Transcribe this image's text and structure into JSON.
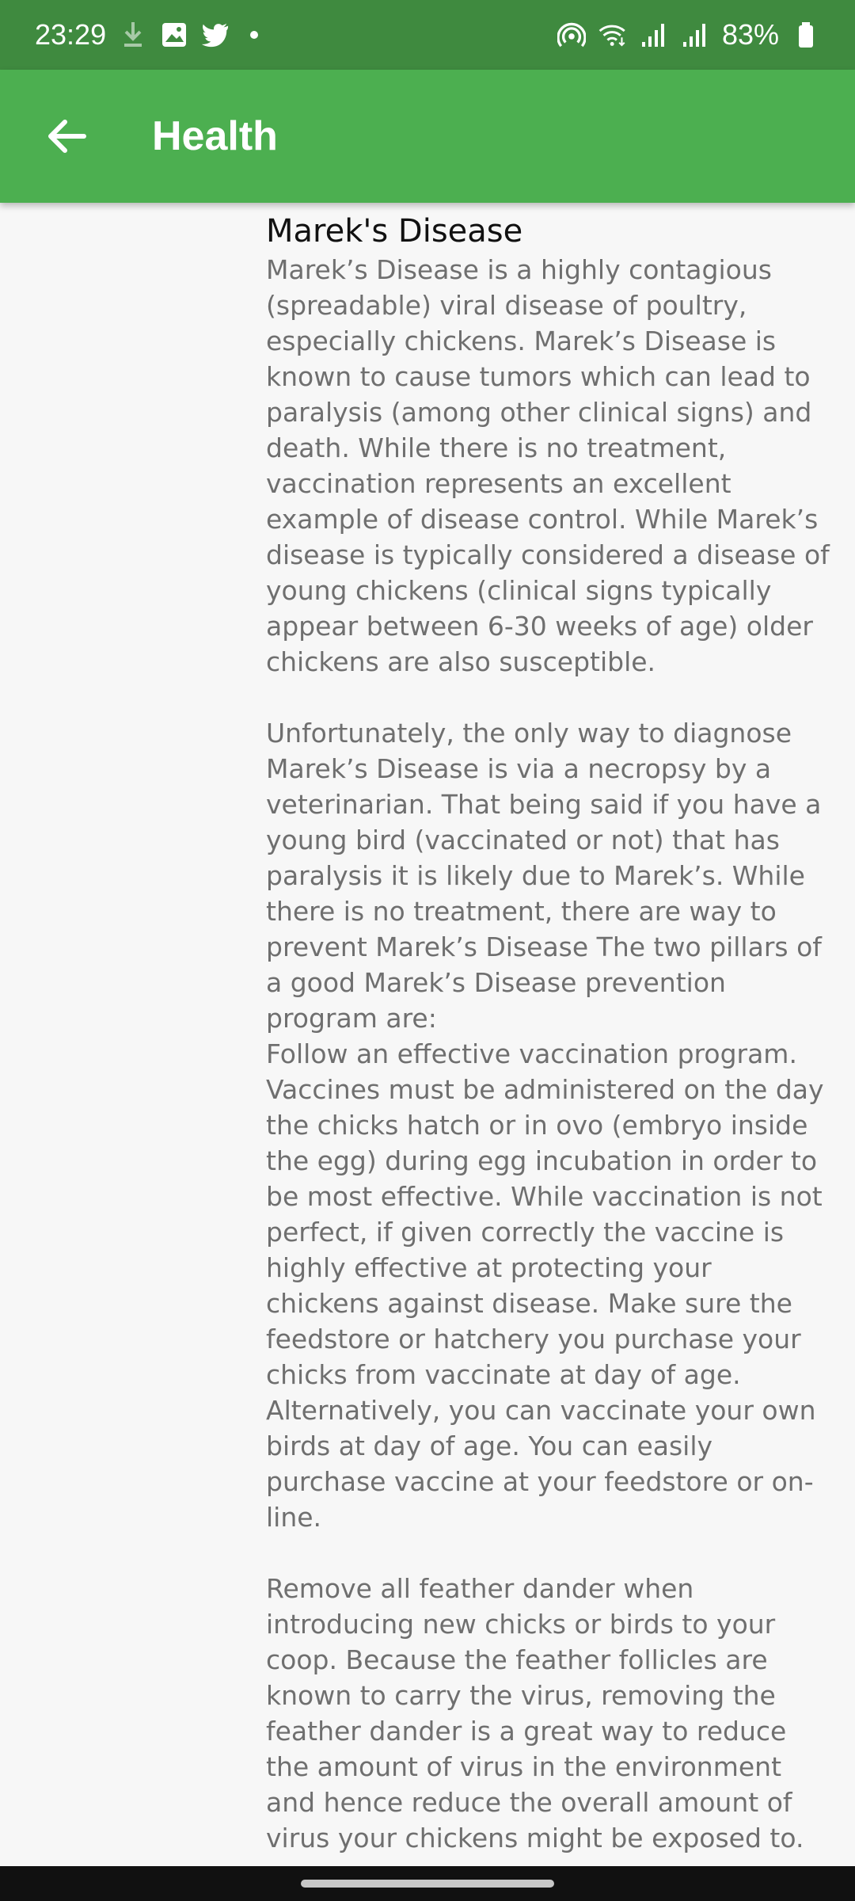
{
  "status_bar": {
    "time": "23:29",
    "battery": "83%",
    "left_icons": [
      "download-icon",
      "image-icon",
      "twitter-icon",
      "dot-icon"
    ],
    "right_icons": [
      "hotspot-icon",
      "wifi-icon",
      "signal-icon",
      "signal-icon",
      "battery-icon"
    ]
  },
  "app_bar": {
    "title": "Health",
    "back_icon": "arrow-left-icon"
  },
  "article": {
    "title": "Marek's Disease",
    "paragraphs": [
      "Marek’s Disease is a highly contagious (spreadable) viral disease of poultry, especially chickens. Marek’s Disease is known to cause tumors which can lead to paralysis (among other clinical signs) and death. While there is no treatment, vaccination represents an excellent example of disease control. While Marek’s disease is typically considered a disease of young chickens (clinical signs typically appear between 6-30 weeks of age) older chickens are also susceptible.",
      "Unfortunately, the only way to diagnose Marek’s Disease is via a necropsy by a veterinarian. That being said if you have a young bird (vaccinated or not) that has paralysis it is likely due to Marek’s.  While there is no treatment, there are way to prevent Marek’s Disease The two pillars of a good Marek’s Disease prevention program are:\nFollow an effective vaccination program. Vaccines must be administered on the day the chicks hatch or in ovo (embryo inside the egg) during egg incubation in order to be most effective. While vaccination is not perfect, if given correctly the vaccine is highly effective at protecting your chickens against disease. Make sure the feedstore or hatchery you purchase your chicks from vaccinate at day of age. Alternatively, you can vaccinate your own birds at day of age. You can easily purchase vaccine at your feedstore or on-line.",
      "Remove all feather dander when introducing new chicks or birds to your coop. Because the feather follicles are known to carry the virus, removing the feather dander is a great way to reduce the amount of virus in the environment and hence reduce the overall amount of virus your chickens might be exposed to."
    ]
  }
}
